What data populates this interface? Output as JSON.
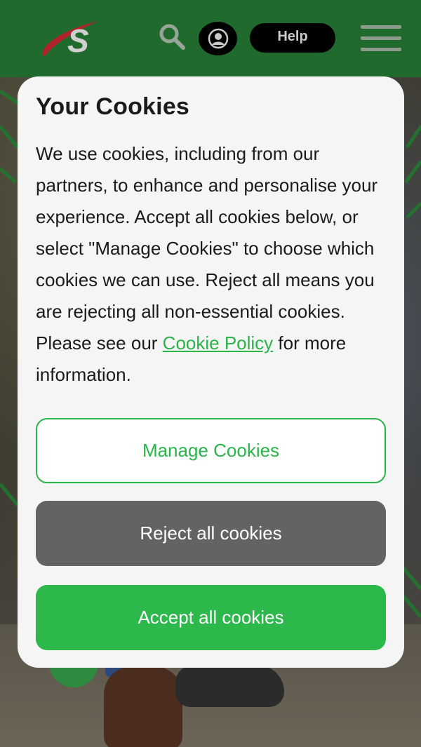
{
  "header": {
    "logo_letter": "S",
    "help_label": "Help",
    "colors": {
      "background": "#1f6a2c",
      "logo_swoosh": "#b3242a"
    }
  },
  "icons": {
    "search": "search-icon",
    "account": "user-icon",
    "menu": "hamburger-menu-icon"
  },
  "cookie_dialog": {
    "title": "Your Cookies",
    "body_text": "We use cookies, including from our partners, to enhance and personalise your experience. Accept all cookies below, or select \"Manage Cookies\" to choose which cookies we can use. Reject all means you are rejecting all non-essential cookies. Please see our ",
    "policy_link_label": "Cookie Policy",
    "body_suffix": " for more information.",
    "manage_label": "Manage Cookies",
    "reject_label": "Reject all cookies",
    "accept_label": "Accept all cookies",
    "colors": {
      "accent_green": "#2ab54a",
      "reject_gray": "#636363"
    }
  }
}
